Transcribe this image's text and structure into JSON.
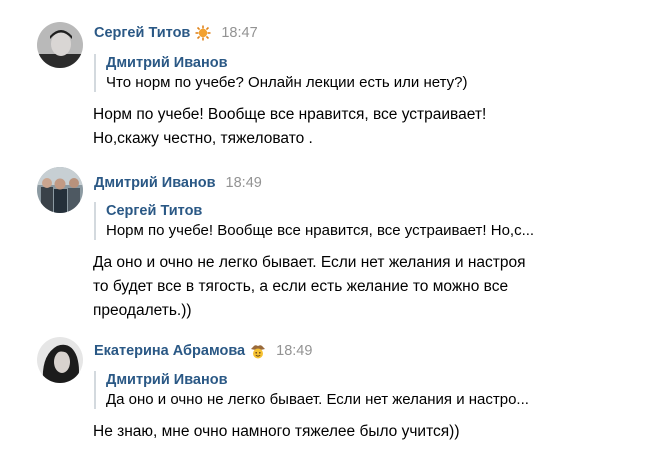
{
  "messages": [
    {
      "author": "Сергей Титов",
      "badge": "sun-badge-icon",
      "time": "18:47",
      "quote": {
        "author": "Дмитрий Иванов",
        "text": "Что норм по учебе? Онлайн лекции есть или нету?)"
      },
      "lines": [
        "Норм по учебе! Вообще все нравится, все устраивает!",
        "Но,скажу честно, тяжеловато ."
      ]
    },
    {
      "author": "Дмитрий Иванов",
      "badge": "",
      "time": "18:49",
      "quote": {
        "author": "Сергей Титов",
        "text": "Норм по учебе! Вообще все нравится, все устраивает! Но,с..."
      },
      "lines": [
        "Да оно и очно не легко бывает. Если нет желания и настроя",
        "то будет все в тягость, а если есть желание то можно все",
        "преодалеть.))"
      ]
    },
    {
      "author": "Екатерина Абрамова",
      "badge": "cowboy-emoji-badge-icon",
      "time": "18:49",
      "quote": {
        "author": "Дмитрий Иванов",
        "text": "Да оно и очно не легко бывает. Если нет желания и настро..."
      },
      "lines": [
        "Не знаю, мне очно намного тяжелее было учится))"
      ]
    }
  ],
  "colors": {
    "author": "#2a5885",
    "time": "#939393",
    "quote_bar": "#d3d9de",
    "text": "#000000"
  }
}
